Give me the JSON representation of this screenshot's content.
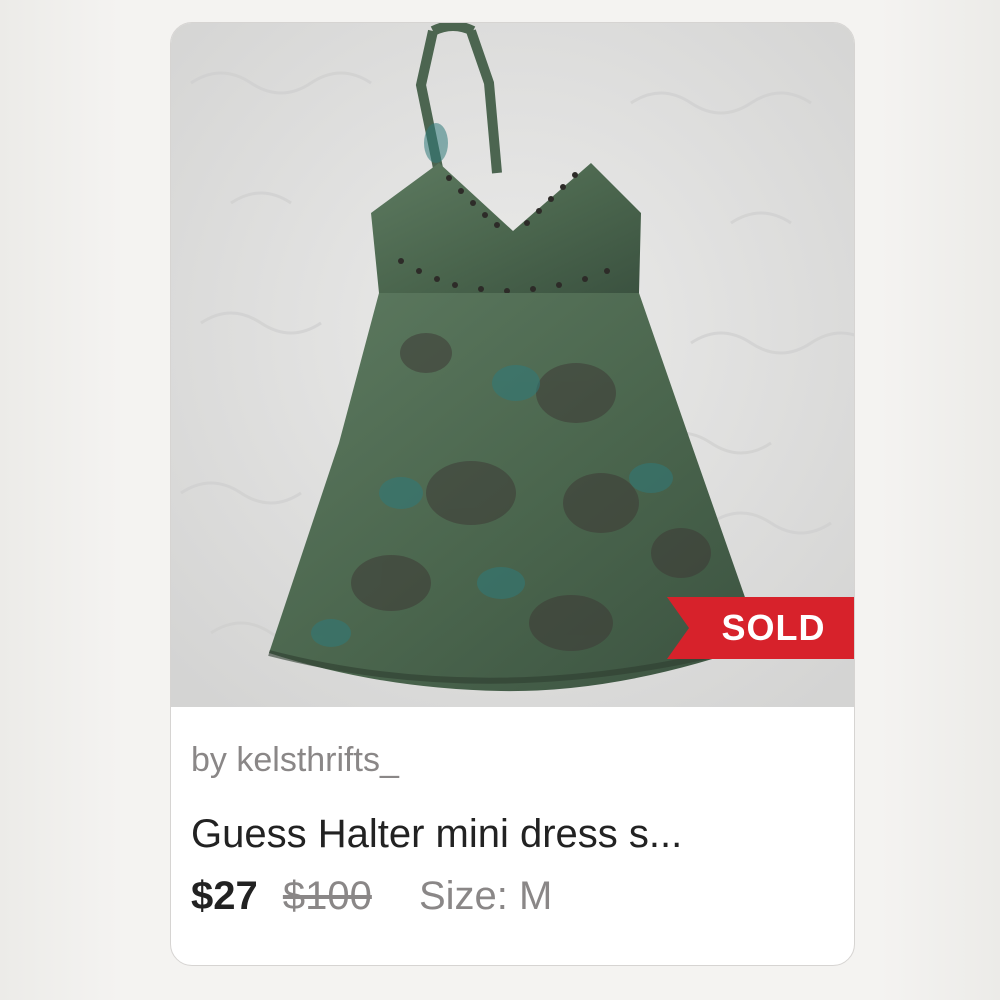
{
  "listing": {
    "seller": "by kelsthrifts_",
    "title": "Guess Halter mini dress s...",
    "price": "$27",
    "original_price": "$100",
    "size": "Size: M",
    "status_badge": "SOLD",
    "image_subject": "green floral halter mini dress photo"
  },
  "colors": {
    "badge": "#d7222b",
    "price": "#222222",
    "muted_text": "#8a8787",
    "dress_green": "#4f6a52"
  }
}
